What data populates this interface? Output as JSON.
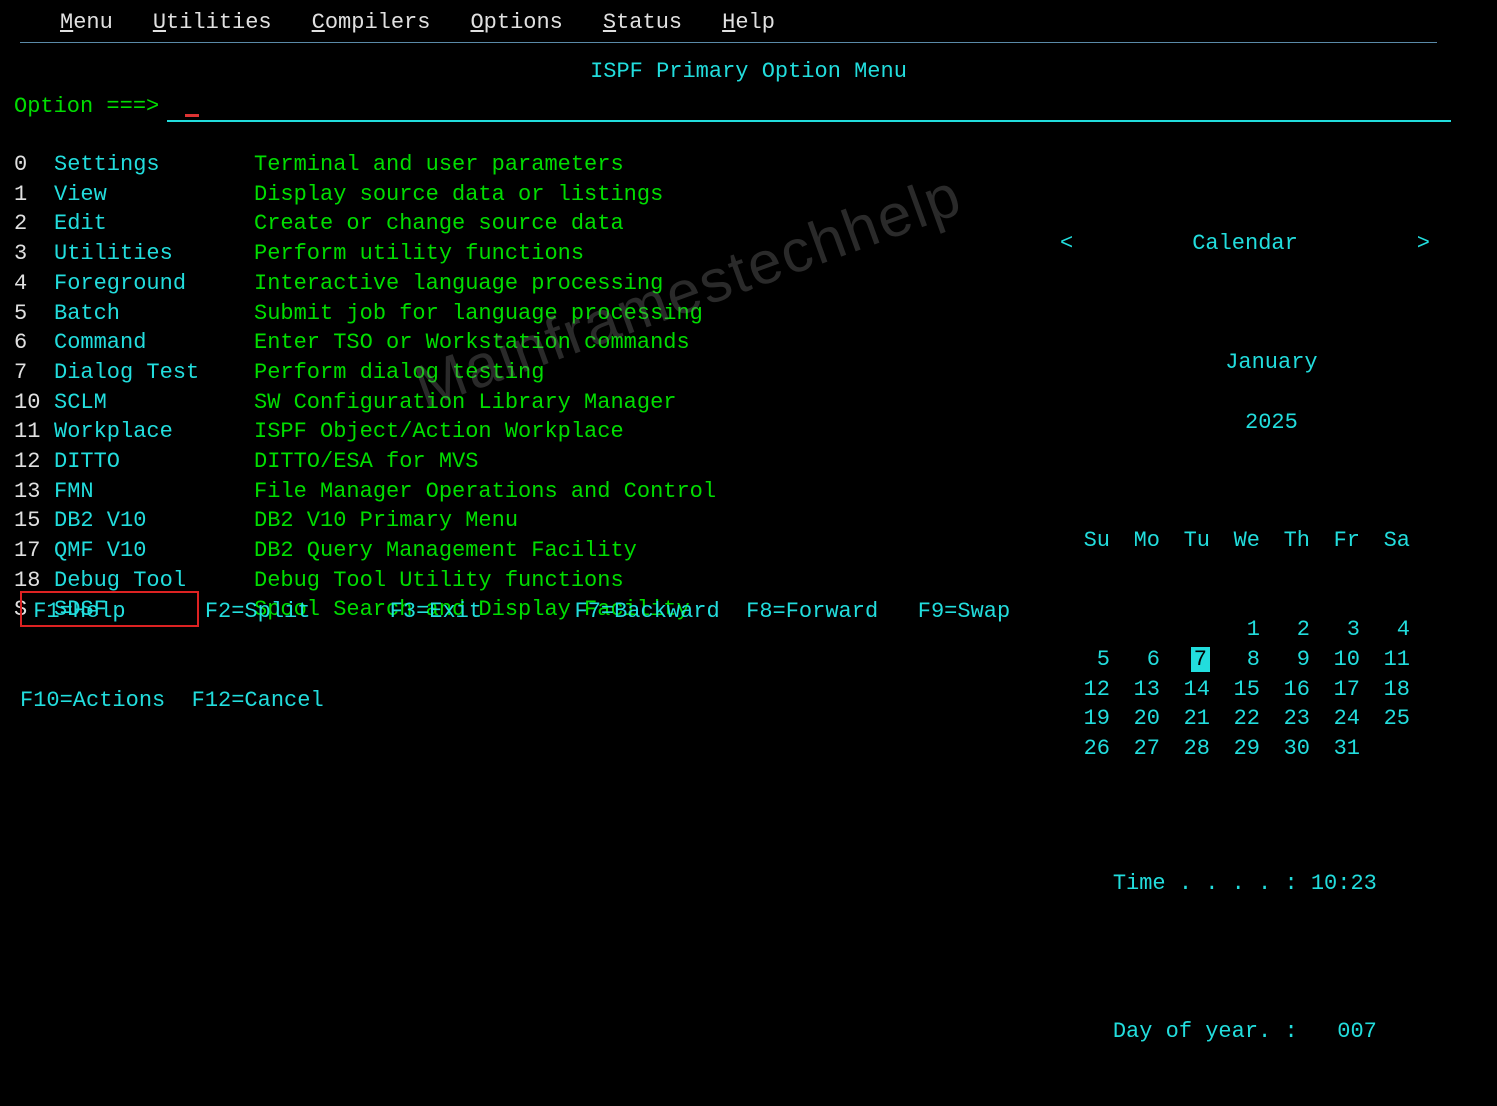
{
  "menubar": [
    "Menu",
    "Utilities",
    "Compilers",
    "Options",
    "Status",
    "Help"
  ],
  "title": "ISPF Primary Option Menu",
  "option_label": "Option ===>",
  "option_value": "",
  "options": [
    {
      "num": "0",
      "name": "Settings",
      "desc": "Terminal and user parameters"
    },
    {
      "num": "1",
      "name": "View",
      "desc": "Display source data or listings"
    },
    {
      "num": "2",
      "name": "Edit",
      "desc": "Create or change source data"
    },
    {
      "num": "3",
      "name": "Utilities",
      "desc": "Perform utility functions"
    },
    {
      "num": "4",
      "name": "Foreground",
      "desc": "Interactive language processing"
    },
    {
      "num": "5",
      "name": "Batch",
      "desc": "Submit job for language processing"
    },
    {
      "num": "6",
      "name": "Command",
      "desc": "Enter TSO or Workstation commands"
    },
    {
      "num": "7",
      "name": "Dialog Test",
      "desc": "Perform dialog testing"
    },
    {
      "num": "10",
      "name": "SCLM",
      "desc": "SW Configuration Library Manager"
    },
    {
      "num": "11",
      "name": "Workplace",
      "desc": "ISPF Object/Action Workplace"
    },
    {
      "num": "12",
      "name": "DITTO",
      "desc": "DITTO/ESA for MVS"
    },
    {
      "num": "13",
      "name": "FMN",
      "desc": "File Manager Operations and Control"
    },
    {
      "num": "15",
      "name": "DB2 V10",
      "desc": "DB2 V10 Primary Menu"
    },
    {
      "num": "17",
      "name": "QMF V10",
      "desc": "DB2 Query Management Facility"
    },
    {
      "num": "18",
      "name": "Debug Tool",
      "desc": "Debug Tool Utility functions"
    },
    {
      "num": "S",
      "name": "SDSF",
      "desc": "Spool Search and Display Facility"
    }
  ],
  "highlighted_option_index": 15,
  "calendar": {
    "title": "Calendar",
    "prev": "<",
    "next": ">",
    "month": "January",
    "year": "2025",
    "day_headers": [
      "Su",
      "Mo",
      "Tu",
      "We",
      "Th",
      "Fr",
      "Sa"
    ],
    "weeks": [
      [
        "",
        "",
        "",
        "1",
        "2",
        "3",
        "4"
      ],
      [
        "5",
        "6",
        "7",
        "8",
        "9",
        "10",
        "11"
      ],
      [
        "12",
        "13",
        "14",
        "15",
        "16",
        "17",
        "18"
      ],
      [
        "19",
        "20",
        "21",
        "22",
        "23",
        "24",
        "25"
      ],
      [
        "26",
        "27",
        "28",
        "29",
        "30",
        "31",
        ""
      ]
    ],
    "today": "7"
  },
  "info": {
    "time_label": "Time . . . . :",
    "time_value": "10:23",
    "doy_label": "Day of year. :",
    "doy_value": "  007"
  },
  "fkeys_line1": " F1=Help      F2=Split      F3=Exit       F7=Backward  F8=Forward   F9=Swap",
  "fkeys_line2": "F10=Actions  F12=Cancel",
  "watermark": "Mainframestechhelp"
}
